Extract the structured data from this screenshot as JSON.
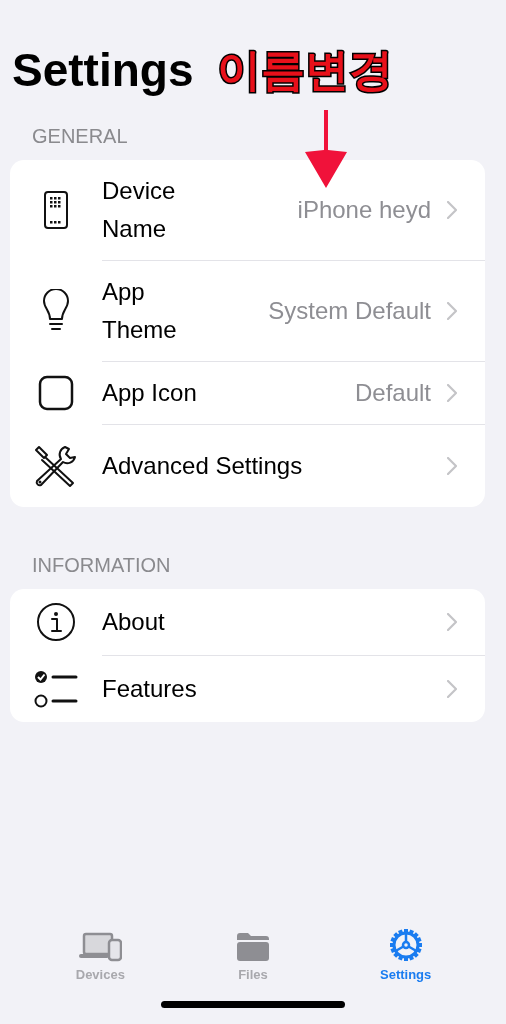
{
  "title": "Settings",
  "annotation": {
    "text": "이름변경"
  },
  "sections": [
    {
      "header": "GENERAL",
      "rows": [
        {
          "kind": "phone",
          "label": "Device Name",
          "value": "iPhone heyd"
        },
        {
          "kind": "bulb",
          "label": "App Theme",
          "value": "System Default"
        },
        {
          "kind": "square",
          "label": "App Icon",
          "value": "Default"
        },
        {
          "kind": "tools",
          "label": "Advanced Settings"
        }
      ]
    },
    {
      "header": "INFORMATION",
      "rows": [
        {
          "kind": "info",
          "label": "About"
        },
        {
          "kind": "checklist",
          "label": "Features"
        }
      ]
    }
  ],
  "tabs": [
    {
      "kind": "devices",
      "label": "Devices",
      "selected": false
    },
    {
      "kind": "folder",
      "label": "Files",
      "selected": false
    },
    {
      "kind": "gear",
      "label": "Settings",
      "selected": true
    }
  ]
}
